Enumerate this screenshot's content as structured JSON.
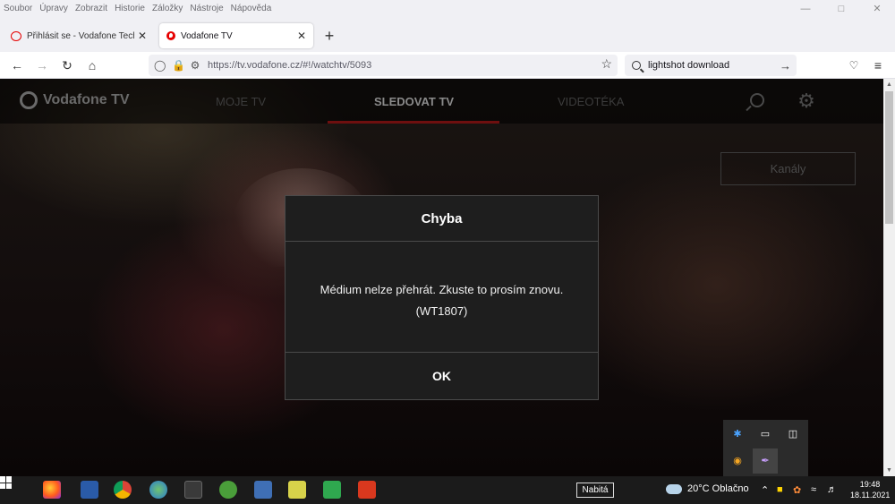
{
  "menubar": {
    "items": [
      "Soubor",
      "Úpravy",
      "Zobrazit",
      "Historie",
      "Záložky",
      "Nástroje",
      "Nápověda"
    ]
  },
  "tabs": [
    {
      "title": "Přihlásit se - Vodafone Techforum"
    },
    {
      "title": "Vodafone TV"
    }
  ],
  "navbar": {
    "url": "https://tv.vodafone.cz/#!/watchtv/5093",
    "search_query": "lightshot download"
  },
  "app": {
    "brand": "Vodafone TV",
    "nav": [
      "MOJE TV",
      "SLEDOVAT TV",
      "VIDEOTÉKA"
    ],
    "active_nav": "SLEDOVAT TV",
    "channels_button": "Kanály"
  },
  "dialog": {
    "title": "Chyba",
    "message": "Médium nelze přehrát. Zkuste to prosím znovu.",
    "code": "(WT1807)",
    "ok_label": "OK"
  },
  "taskbar": {
    "battery_label": "Nabitá",
    "weather": "20°C  Oblačno",
    "time": "19:48",
    "date": "18.11.2021"
  },
  "colors": {
    "vodafone_red": "#e60000",
    "dialog_bg": "#1e1e1e",
    "taskbar_bg": "#1b1b1b"
  }
}
